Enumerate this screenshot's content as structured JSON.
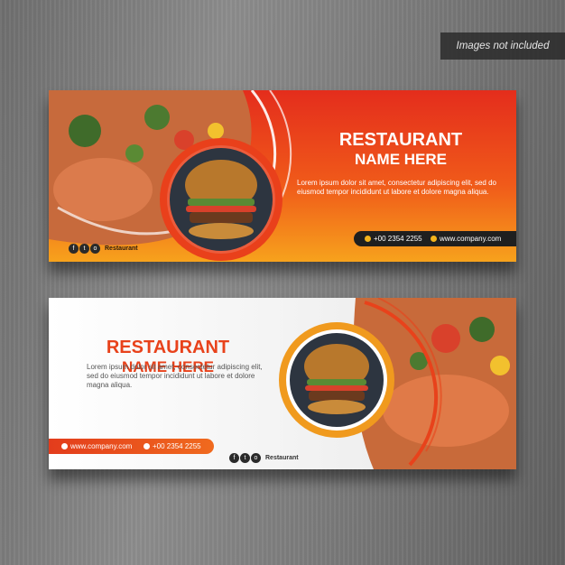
{
  "notice": "Images not included",
  "banners": [
    {
      "title": "RESTAURANT",
      "subtitle": "NAME HERE",
      "body": "Lorem ipsum dolor sit amet, consectetur adipiscing elit, sed do eiusmod tempor incididunt ut labore et dolore magna aliqua.",
      "phone": "+00 2354 2255",
      "website": "www.company.com",
      "social_label": "Restaurant",
      "colors": {
        "accent": "#e42d1c",
        "gradient_end": "#f7a21c"
      }
    },
    {
      "title": "RESTAURANT",
      "subtitle": "NAME HERE",
      "body": "Lorem ipsum dolor sit amet, consectetur adipiscing elit, sed do eiusmod tempor incididunt ut labore et dolore magna aliqua.",
      "website": "www.company.com",
      "phone": "+00 2354 2255",
      "social_label": "Restaurant",
      "colors": {
        "accent": "#e8421b",
        "background": "#f1f1f1"
      }
    }
  ],
  "icons": [
    "phone-icon",
    "globe-icon",
    "facebook-icon",
    "twitter-icon",
    "instagram-icon"
  ]
}
